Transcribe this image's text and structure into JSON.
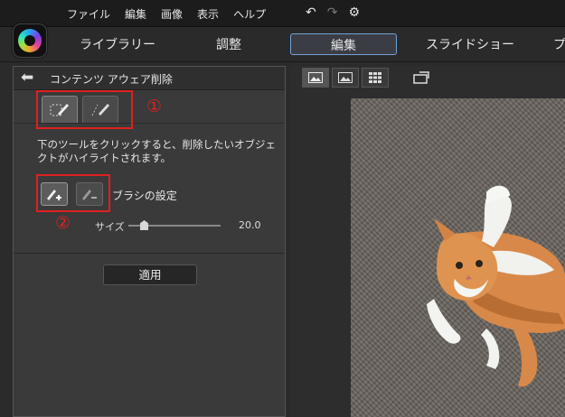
{
  "menu": [
    "ファイル",
    "編集",
    "画像",
    "表示",
    "ヘルプ"
  ],
  "topbar_icons": [
    "undo-icon",
    "redo-icon",
    "gear-icon"
  ],
  "nav": {
    "library": "ライブラリー",
    "adjust": "調整",
    "edit": "編集",
    "slideshow": "スライドショー",
    "cut": "プ"
  },
  "panel": {
    "title": "コンテンツ アウェア削除",
    "description": "下のツールをクリックすると、削除したいオブジェクトがハイライトされます。",
    "brush_settings": "ブラシの設定",
    "size_label": "サイズ",
    "size_value": "20.0",
    "apply": "適用",
    "marker_1": "①",
    "marker_2": "②"
  },
  "colors": {
    "accent": "#6ea4d4",
    "highlight": "#e02020"
  },
  "slider": {
    "value": 20.0,
    "fraction": 0.2
  }
}
